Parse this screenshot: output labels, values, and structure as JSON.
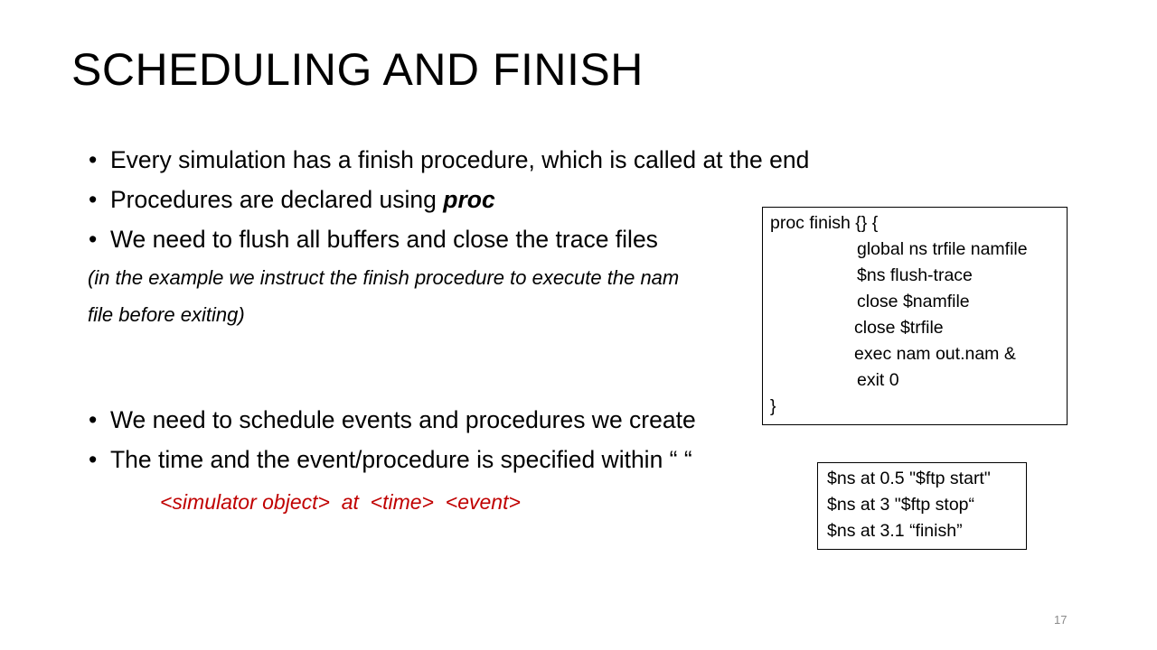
{
  "slide": {
    "title": "SCHEDULING AND FINISH",
    "bullets": [
      "Every simulation has a finish procedure, which is called at the end",
      "Procedures are declared using ",
      "We need to flush all buffers and close the trace files",
      "We need to schedule events and procedures we create",
      "The time and the event/procedure is specified within “ “"
    ],
    "bullet_emphasis": "proc",
    "bullet_symbol": "•",
    "note_lines": [
      "(in the example we instruct the finish procedure to execute the nam",
      "file before exiting)"
    ],
    "syntax_line": "<simulator object>  at  <time>  <event>",
    "syntax_color": "#c00000",
    "finish_code": [
      "proc finish {} {",
      "global ns trfile namfile",
      "$ns flush-trace",
      "close $namfile",
      "close $trfile",
      "exec nam out.nam &",
      "exit 0",
      "}"
    ],
    "schedule_code": [
      "$ns at 0.5 \"$ftp start\"",
      "$ns at 3 \"$ftp stop“",
      "$ns at 3.1 “finish”"
    ],
    "page_number": "17"
  }
}
